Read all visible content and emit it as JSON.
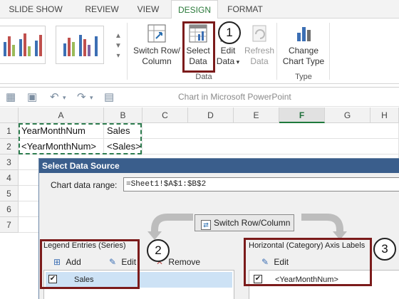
{
  "ribbon": {
    "tabs": [
      "SLIDE SHOW",
      "REVIEW",
      "VIEW",
      "DESIGN",
      "FORMAT"
    ],
    "active_tab": "DESIGN",
    "buttons": {
      "switch_row_column": "Switch Row/\nColumn",
      "select_data": "Select\nData",
      "edit_data": "Edit\nData",
      "refresh_data": "Refresh\nData",
      "change_chart_type": "Change\nChart Type"
    },
    "groups": {
      "data": "Data",
      "type": "Type"
    }
  },
  "callouts": [
    "1",
    "2",
    "3"
  ],
  "excel": {
    "title": "Chart in Microsoft PowerPoint",
    "columns": [
      "A",
      "B",
      "C",
      "D",
      "E",
      "F",
      "G",
      "H"
    ],
    "selected_column": "F",
    "rows": [
      "1",
      "2",
      "3",
      "4",
      "5",
      "6",
      "7"
    ],
    "cells": {
      "A1": "YearMonthNum",
      "B1": "Sales",
      "A2": "<YearMonthNum>",
      "B2": "<Sales>"
    }
  },
  "dialog": {
    "title": "Select Data Source",
    "range_label": "Chart data range:",
    "range_value": "=Sheet1!$A$1:$B$2",
    "switch_button": "Switch Row/Column",
    "legend_panel": {
      "title": "Legend Entries (Series)",
      "add": "Add",
      "edit": "Edit",
      "remove": "Remove",
      "items": [
        {
          "label": "Sales",
          "checked": true
        }
      ]
    },
    "axis_panel": {
      "title": "Horizontal (Category) Axis Labels",
      "edit": "Edit",
      "items": [
        {
          "label": "<YearMonthNum>",
          "checked": true
        }
      ]
    }
  },
  "colors": {
    "accent_green": "#2b7a3b",
    "callout_box": "#7b1b1b",
    "dialog_title_bar": "#3a5e8c"
  }
}
